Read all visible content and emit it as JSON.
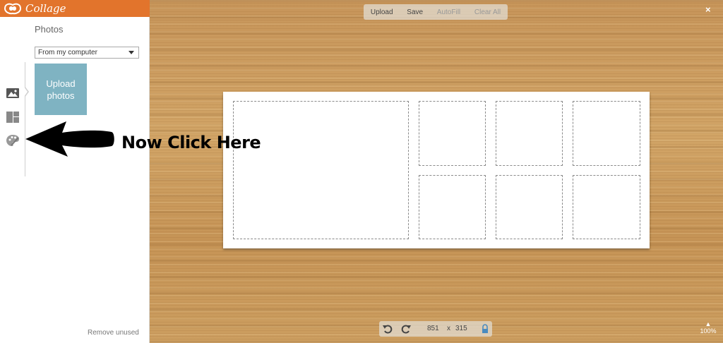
{
  "app": {
    "brand": "Collage",
    "brand_color": "#e2742c"
  },
  "sidebar": {
    "title": "Photos",
    "source_select": {
      "value": "From my computer"
    },
    "upload_tile": {
      "label": "Upload\nphotos",
      "color": "#7fb3c2"
    },
    "rail": [
      {
        "icon": "photos-icon",
        "active": true
      },
      {
        "icon": "layout-icon",
        "active": false
      },
      {
        "icon": "palette-icon",
        "active": false
      }
    ],
    "footer_link": "Remove unused"
  },
  "toolbar": {
    "items": [
      {
        "label": "Upload",
        "enabled": true
      },
      {
        "label": "Save",
        "enabled": true
      },
      {
        "label": "AutoFill",
        "enabled": false
      },
      {
        "label": "Clear All",
        "enabled": false
      }
    ],
    "close_label": "×"
  },
  "canvas": {
    "width_value": "851",
    "times": "x",
    "height_value": "315",
    "cells_count": 7
  },
  "zoom": {
    "caret": "▲",
    "value": "100%"
  },
  "annotation": {
    "text": "Now Click Here"
  }
}
